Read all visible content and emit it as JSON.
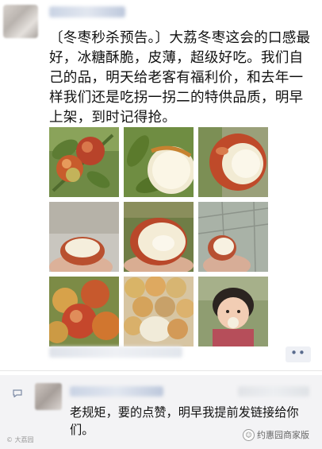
{
  "post": {
    "text": "〔冬枣秒杀预告。〕大荔冬枣这会的口感最好，冰糖酥脆，皮薄，超级好吃。我们自己的品，明天给老客有福利价，和去年一样我们还是吃拐一拐二的特供品质，明早上架，到时记得抢。",
    "more_label": "••"
  },
  "comment": {
    "text": "老规矩，要的点赞，明早我提前发链接给你们。"
  },
  "watermark": {
    "left_text": "© 大荔园",
    "right_text": "约惠园商家版",
    "logo_glyph": "☺"
  },
  "colors": {
    "link_blue": "#5a6c8e",
    "comment_bg": "#f3f3f5"
  }
}
